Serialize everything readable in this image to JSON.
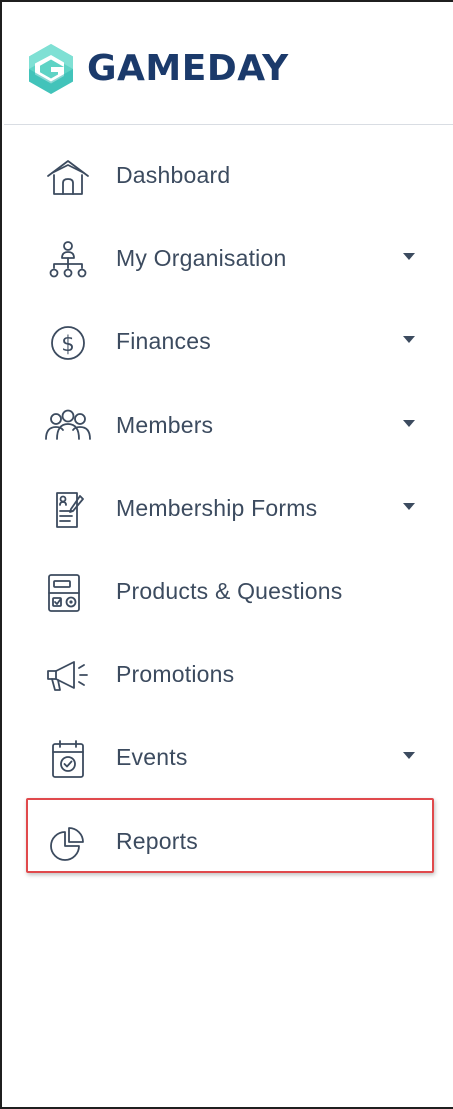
{
  "brand": {
    "name": "GAMEDAY",
    "logo_icon": "gameday-logo-icon",
    "colors": {
      "text": "#1b3a6b",
      "mark_light": "#5ed3c5",
      "mark_dark": "#2bb6b0"
    }
  },
  "nav": {
    "items": [
      {
        "label": "Dashboard",
        "icon": "home-icon",
        "has_submenu": false
      },
      {
        "label": "My Organisation",
        "icon": "org-chart-icon",
        "has_submenu": true
      },
      {
        "label": "Finances",
        "icon": "dollar-circle-icon",
        "has_submenu": true
      },
      {
        "label": "Members",
        "icon": "members-icon",
        "has_submenu": true
      },
      {
        "label": "Membership Forms",
        "icon": "form-icon",
        "has_submenu": true
      },
      {
        "label": "Products & Questions",
        "icon": "products-icon",
        "has_submenu": false
      },
      {
        "label": "Promotions",
        "icon": "megaphone-icon",
        "has_submenu": false
      },
      {
        "label": "Events",
        "icon": "calendar-icon",
        "has_submenu": true
      },
      {
        "label": "Reports",
        "icon": "pie-chart-icon",
        "has_submenu": false,
        "highlighted": true
      }
    ]
  },
  "colors": {
    "nav_text": "#3c4b5f",
    "divider": "#d9dde3",
    "highlight": "#e0494c"
  }
}
